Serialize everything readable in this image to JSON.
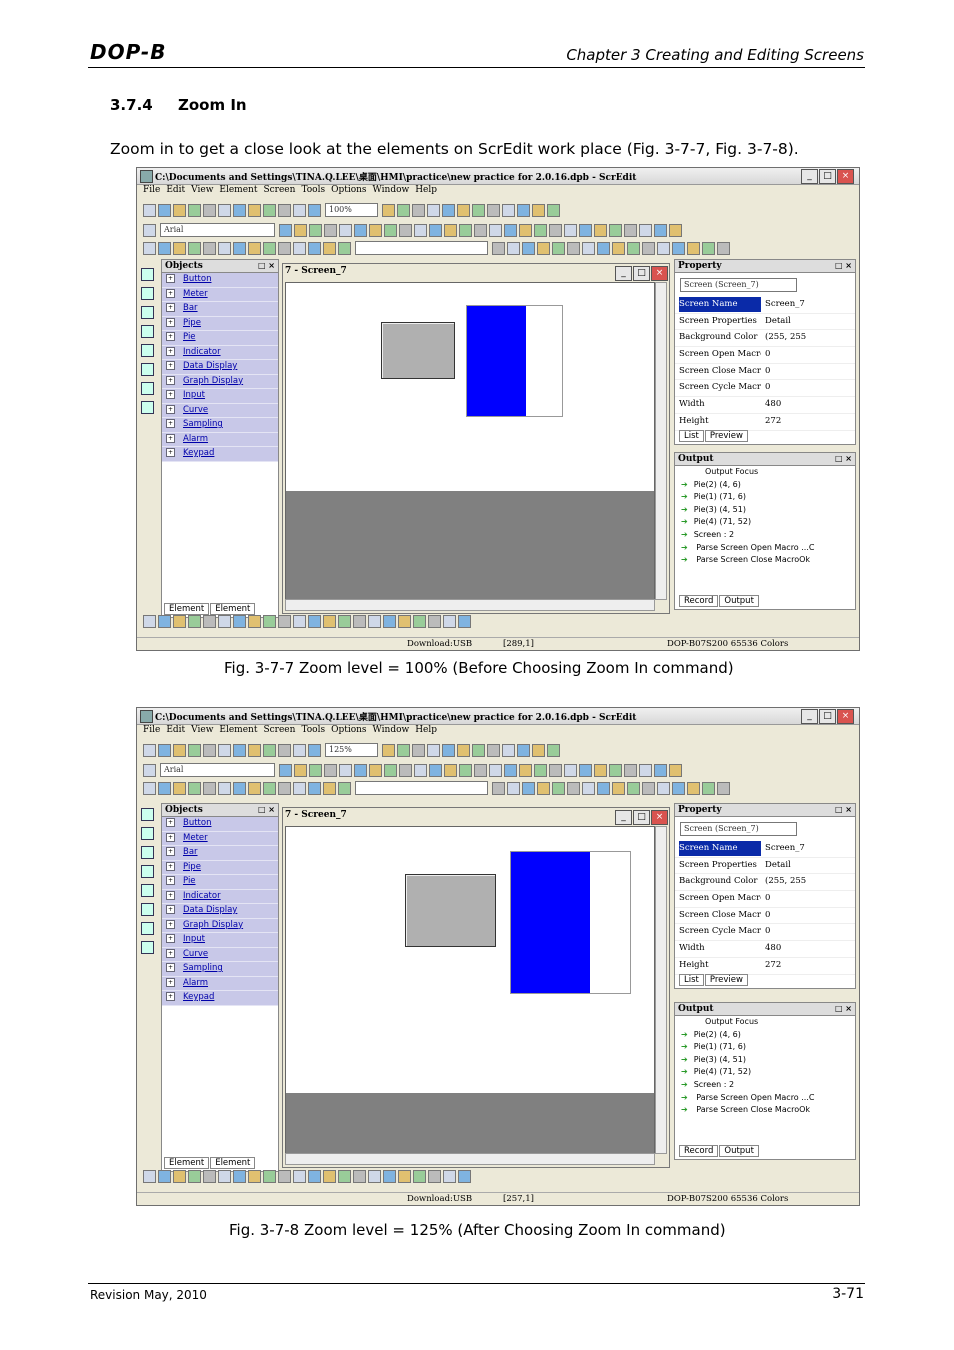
{
  "header": {
    "logo": "DOP-B",
    "chapter": "Chapter 3 Creating and Editing Screens"
  },
  "section": {
    "number": "3.7.4",
    "title": "Zoom In",
    "intro": "Zoom in to get a close look at the elements on ScrEdit work place (Fig. 3-7-7, Fig. 3-7-8)."
  },
  "figures": [
    {
      "caption": "Fig. 3-7-7 Zoom level = 100% (Before Choosing Zoom In command)",
      "window_title": "C:\\Documents and Settings\\TINA.Q.LEE\\桌面\\HMI\\practice\\new practice for 2.0.16.dpb - ScrEdit",
      "zoom": "100%",
      "status_coords": "[289,1]"
    },
    {
      "caption": "Fig. 3-7-8 Zoom level = 125% (After Choosing Zoom In command)",
      "window_title": "C:\\Documents and Settings\\TINA.Q.LEE\\桌面\\HMI\\practice\\new practice for 2.0.16.dpb - ScrEdit",
      "zoom": "125%",
      "status_coords": "[257,1]"
    }
  ],
  "app": {
    "menu": [
      "File",
      "Edit",
      "View",
      "Element",
      "Screen",
      "Tools",
      "Options",
      "Window",
      "Help"
    ],
    "font_combo": "Arial",
    "objects_title": "Objects",
    "objects": [
      "Button",
      "Meter",
      "Bar",
      "Pipe",
      "Pie",
      "Indicator",
      "Data Display",
      "Graph Display",
      "Input",
      "Curve",
      "Sampling",
      "Alarm",
      "Keypad"
    ],
    "objects_tabs": [
      "Element",
      "Element"
    ],
    "screen_title": "7 - Screen_7",
    "property_title": "Property",
    "property_combo": "Screen (Screen_7)",
    "properties": [
      {
        "k": "Screen Name",
        "v": "Screen_7"
      },
      {
        "k": "Screen Properties",
        "v": "Detail"
      },
      {
        "k": "Background Color",
        "v": "(255, 255"
      },
      {
        "k": "Screen Open Macro",
        "v": "0"
      },
      {
        "k": "Screen Close Macro",
        "v": "0"
      },
      {
        "k": "Screen Cycle Macro",
        "v": "0"
      },
      {
        "k": "Width",
        "v": "480"
      },
      {
        "k": "Height",
        "v": "272"
      }
    ],
    "property_tabs": [
      "List",
      "Preview"
    ],
    "output_title": "Output",
    "output_focus": "Output Focus",
    "output_lines": [
      "Pie(2) (4, 6)",
      "Pie(1) (71, 6)",
      "Pie(3) (4, 51)",
      "Pie(4) (71, 52)",
      "Screen : 2",
      " Parse Screen Open Macro ...C",
      " Parse Screen Close MacroOk"
    ],
    "output_tabs": [
      "Record",
      "Output"
    ],
    "status_download": "Download:USB",
    "status_model": "DOP-B07S200 65536 Colors"
  },
  "footer": {
    "revision": "Revision May, 2010",
    "page": "3-71"
  }
}
